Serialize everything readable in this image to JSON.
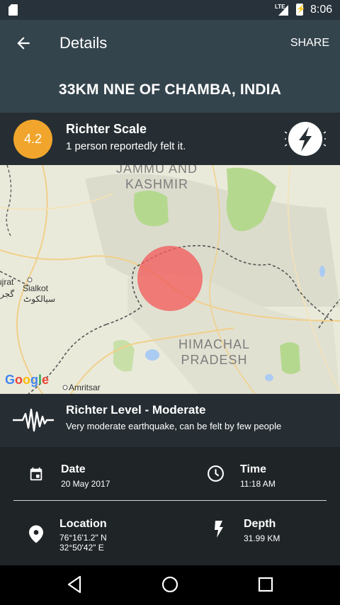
{
  "status_bar": {
    "network": "LTE",
    "time": "8:06"
  },
  "app_bar": {
    "title": "Details",
    "share_label": "SHARE"
  },
  "location_title": "33KM NNE OF CHAMBA, INDIA",
  "richter": {
    "magnitude": "4.2",
    "title": "Richter Scale",
    "felt_text": "1 person reportedly felt it."
  },
  "map": {
    "labels": {
      "region1_line1": "JAMMU AND",
      "region1_line2": "KASHMIR",
      "region2_line1": "HIMACHAL",
      "region2_line2": "PRADESH",
      "city1": "Sialkot",
      "city1_script": "سیالکوٹ",
      "city2": "Amritsar",
      "partial_left": "ujrat",
      "partial_left2": "گجر"
    },
    "brand": "Google"
  },
  "level": {
    "title": "Richter Level - Moderate",
    "description": "Very moderate earthquake, can be felt by few people"
  },
  "details": {
    "date_label": "Date",
    "date_value": "20 May 2017",
    "time_label": "Time",
    "time_value": "11:18 AM",
    "location_label": "Location",
    "lon_value": "76°16'1.2\" N",
    "lat_value": "32°50'42\" E",
    "depth_label": "Depth",
    "depth_value": "31.99 KM"
  },
  "colors": {
    "magnitude_badge": "#f1a52c",
    "app_bar": "#34444d",
    "epicenter": "#f25c5c"
  },
  "icons": [
    "back-arrow-icon",
    "lightning-bolt-icon",
    "seismic-wave-icon",
    "calendar-icon",
    "clock-icon",
    "location-pin-icon",
    "flash-icon",
    "nav-back-icon",
    "nav-home-icon",
    "nav-recents-icon"
  ]
}
